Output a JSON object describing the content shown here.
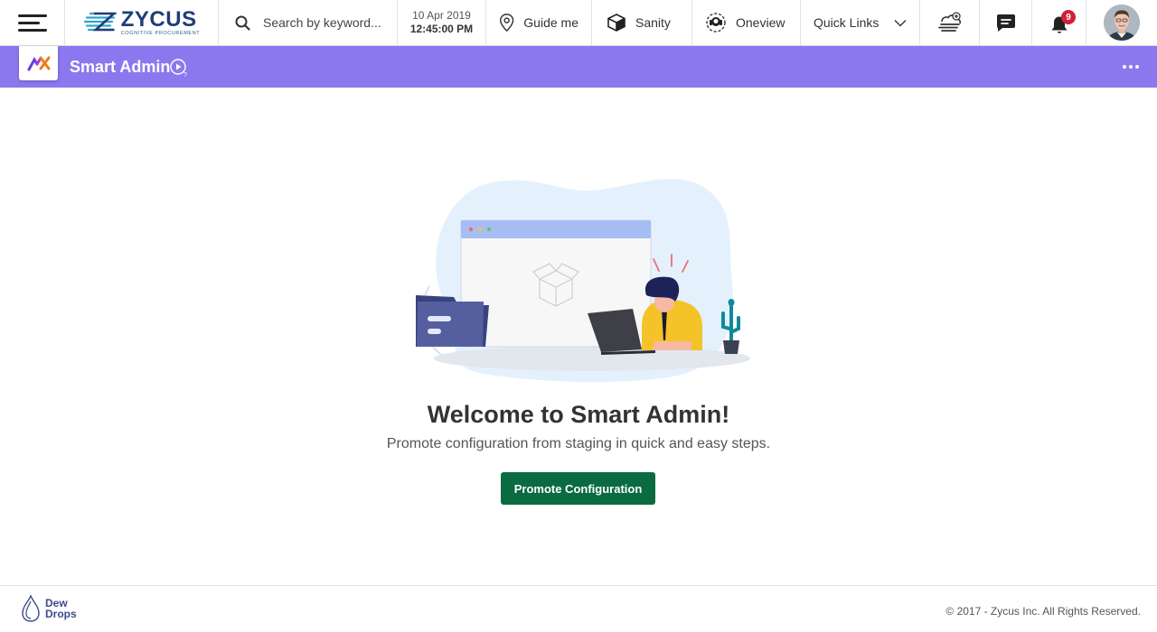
{
  "topbar": {
    "logo": {
      "main": "ZYCUS",
      "sub": "COGNITIVE PROCUREMENT"
    },
    "search": {
      "placeholder": "Search by keyword..."
    },
    "datetime": {
      "date": "10 Apr 2019",
      "time": "12:45:00 PM"
    },
    "nav": {
      "guide": "Guide me",
      "sanity": "Sanity",
      "oneview": "Oneview",
      "quick_links": "Quick Links"
    },
    "notifications": {
      "count": "9"
    }
  },
  "app_header": {
    "title": "Smart Admin",
    "background": "#8c78ee"
  },
  "main": {
    "welcome": "Welcome to Smart Admin!",
    "subtitle": "Promote configuration from staging in quick and easy steps.",
    "cta": "Promote Configuration",
    "cta_color": "#0a6b40"
  },
  "footer": {
    "brand": {
      "line1": "Dew",
      "line2": "Drops"
    },
    "copyright": "© 2017 - Zycus Inc. All Rights Reserved."
  },
  "icons": [
    "menu-icon",
    "search-icon",
    "location-pin-icon",
    "box-icon",
    "headset-icon",
    "chevron-down-icon",
    "cloud-add-icon",
    "chat-icon",
    "bell-icon",
    "play-help-icon",
    "more-icon",
    "drop-icon"
  ]
}
